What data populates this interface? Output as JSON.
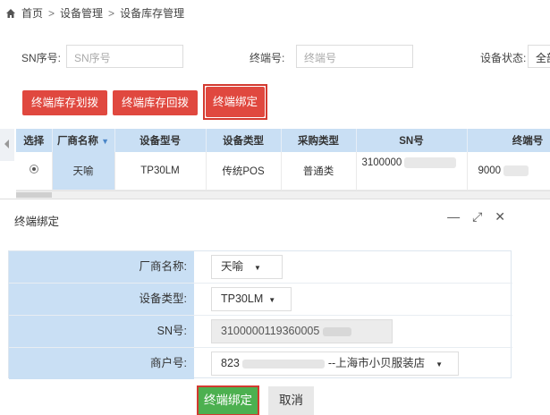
{
  "breadcrumb": {
    "home": "首页",
    "sep": ">",
    "level1": "设备管理",
    "level2": "设备库存管理"
  },
  "filters": {
    "sn_label": "SN序号:",
    "sn_placeholder": "SN序号",
    "terminal_label": "终端号:",
    "terminal_placeholder": "终端号",
    "status_label": "设备状态:",
    "status_value": "全部"
  },
  "actions": {
    "allocate": "终端库存划拨",
    "recall": "终端库存回拨",
    "bind": "终端绑定"
  },
  "table": {
    "headers": [
      "选择",
      "厂商名称",
      "设备型号",
      "设备类型",
      "采购类型",
      "SN号",
      "终端号"
    ],
    "rows": [
      {
        "vendor": "天喻",
        "model": "TP30LM",
        "device_type": "传统POS",
        "purchase_type": "普通类",
        "sn": "3100000",
        "terminal": "9000"
      }
    ]
  },
  "dialog": {
    "title": "终端绑定",
    "controls": {
      "minimize": "—",
      "maximize": "⤢",
      "close": "✕"
    },
    "fields": {
      "vendor_label": "厂商名称:",
      "vendor_value": "天喻",
      "device_type_label": "设备类型:",
      "device_type_value": "TP30LM",
      "sn_label": "SN号:",
      "sn_value": "3100000119360005",
      "merchant_label": "商户号:",
      "merchant_prefix": "823",
      "merchant_suffix": "--上海市小贝服装店"
    },
    "buttons": {
      "confirm": "终端绑定",
      "cancel": "取消"
    }
  },
  "colors": {
    "header_bg": "#c9dff4",
    "red": "#e0483f",
    "green": "#4cb050",
    "highlight_border": "#d33a30"
  }
}
